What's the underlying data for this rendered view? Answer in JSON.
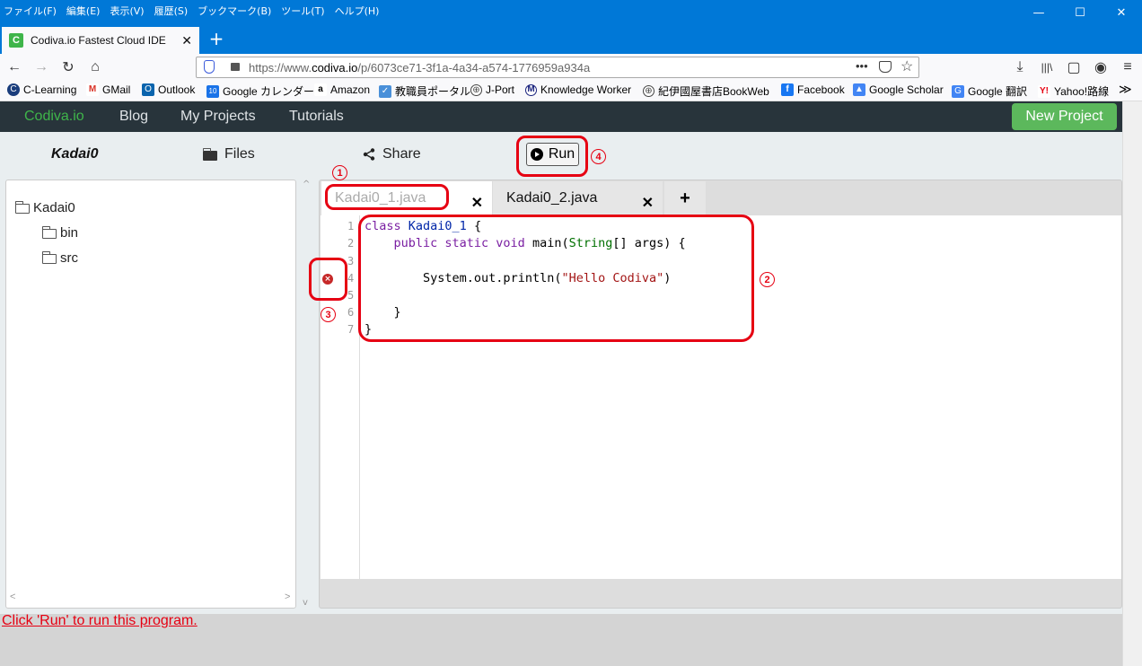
{
  "menubar": {
    "items": [
      "ファイル(F)",
      "編集(E)",
      "表示(V)",
      "履歴(S)",
      "ブックマーク(B)",
      "ツール(T)",
      "ヘルプ(H)"
    ]
  },
  "window_controls": {
    "minimize": "—",
    "maximize": "☐",
    "close": "✕"
  },
  "browser_tab": {
    "favicon": "C",
    "title": "Codiva.io Fastest Cloud IDE",
    "close": "✕"
  },
  "new_tab": "+",
  "nav": {
    "back": "←",
    "forward": "→",
    "reload": "↻",
    "home": "⌂",
    "url_prefix": "https://www.",
    "url_domain": "codiva.io",
    "url_path": "/p/6073ce71-3f1a-4a34-a574-1776959a934a",
    "more": "•••",
    "download": "⤓",
    "library": "|||\\",
    "sidebar": "▢",
    "account": "◉",
    "menu": "≡"
  },
  "bookmarks": [
    "C-Learning",
    "GMail",
    "Outlook",
    "Google カレンダー",
    "Amazon",
    "教職員ポータル",
    "J-Port",
    "Knowledge Worker",
    "紀伊國屋書店BookWeb",
    "Facebook",
    "Google Scholar",
    "Google 翻訳",
    "Yahoo!路線"
  ],
  "bookmarks_more": "≫",
  "appnav": {
    "brand": "Codiva.io",
    "blog": "Blog",
    "my_projects": "My Projects",
    "tutorials": "Tutorials",
    "new_project": "New Project"
  },
  "toolbar": {
    "project_name": "Kadai0",
    "files": "Files",
    "share": "Share",
    "run": "Run"
  },
  "file_tree": {
    "root": "Kadai0",
    "children": [
      "bin",
      "src"
    ]
  },
  "editor_tabs": [
    {
      "label": "Kadai0_1.java",
      "close": "✕"
    },
    {
      "label": "Kadai0_2.java",
      "close": "✕"
    }
  ],
  "add_tab": "+",
  "code": {
    "line_numbers": [
      "1",
      "2",
      "3",
      "4",
      "5",
      "6",
      "7"
    ],
    "l1_kw": "class",
    "l1_cls": "Kadai0_1",
    "l1_rest": " {",
    "l2_kw": "public static void",
    "l2_mid": " main(",
    "l2_typ": "String",
    "l2_rest": "[] args) {",
    "l4_pre": "System.out.println(",
    "l4_str": "\"Hello Codiva\"",
    "l4_rest": ")",
    "l6": "}",
    "l7": "}"
  },
  "error_marker": "×",
  "annotations": {
    "a1": "1",
    "a2": "2",
    "a3": "3",
    "a4": "4",
    "color": "#e60012"
  },
  "status": {
    "message": "Click 'Run' to run this program."
  },
  "scrollbar": {
    "left_arrow": "<",
    "right_arrow": ">",
    "up_arrow": "^",
    "down_arrow": "v"
  },
  "colors": {
    "titlebar": "#0078d7",
    "appnav": "#28343b",
    "brand": "#3fb54a",
    "new_project": "#5cb85c",
    "status_text": "#e60012"
  }
}
